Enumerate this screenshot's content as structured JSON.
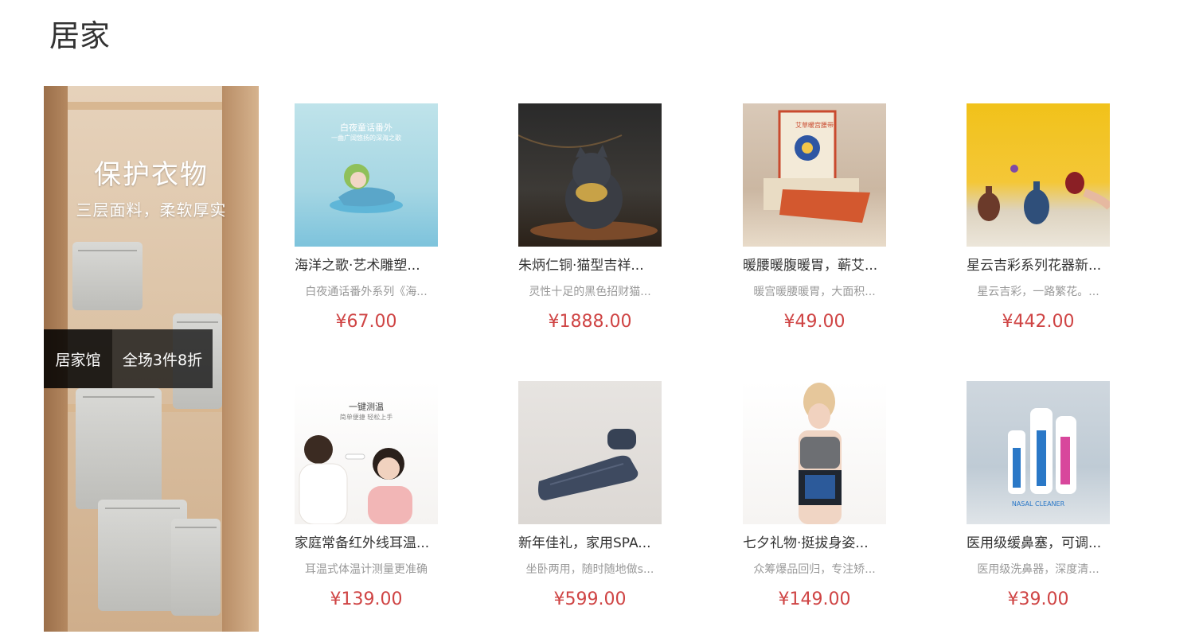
{
  "section": {
    "title": "居家"
  },
  "banner": {
    "headline": "保护衣物",
    "subline": "三层面料，柔软厚实",
    "promo_label": "居家馆",
    "promo_text": "全场3件8折"
  },
  "products": [
    {
      "name": "海洋之歌·艺术雕塑...",
      "desc": "白夜通话番外系列《海...",
      "price": "¥67.00",
      "thumb_caption": "白夜童话番外",
      "thumb_caption2": "一曲广阔悠扬的深海之歌"
    },
    {
      "name": "朱炳仁铜·猫型吉祥...",
      "desc": "灵性十足的黑色招财猫...",
      "price": "¥1888.00"
    },
    {
      "name": "暖腰暖腹暖胃，蕲艾...",
      "desc": "暖宫暖腰暖胃，大面积...",
      "price": "¥49.00",
      "thumb_caption": "艾草暖宫腰带"
    },
    {
      "name": "星云吉彩系列花器新...",
      "desc": "星云吉彩，一路繁花。...",
      "price": "¥442.00"
    },
    {
      "name": "家庭常备红外线耳温...",
      "desc": "耳温式体温计测量更准确",
      "price": "¥139.00",
      "thumb_caption": "一键测温",
      "thumb_caption2": "简单便捷 轻松上手"
    },
    {
      "name": "新年佳礼，家用SPA...",
      "desc": "坐卧两用，随时随地做s...",
      "price": "¥599.00"
    },
    {
      "name": "七夕礼物·挺拔身姿...",
      "desc": "众筹爆品回归，专注矫...",
      "price": "¥149.00"
    },
    {
      "name": "医用级缓鼻塞，可调...",
      "desc": "医用级洗鼻器，深度清...",
      "price": "¥39.00",
      "thumb_caption": "NASAL CLEANER"
    }
  ],
  "colors": {
    "price": "#cf4444",
    "title": "#333333",
    "desc": "#999999"
  }
}
